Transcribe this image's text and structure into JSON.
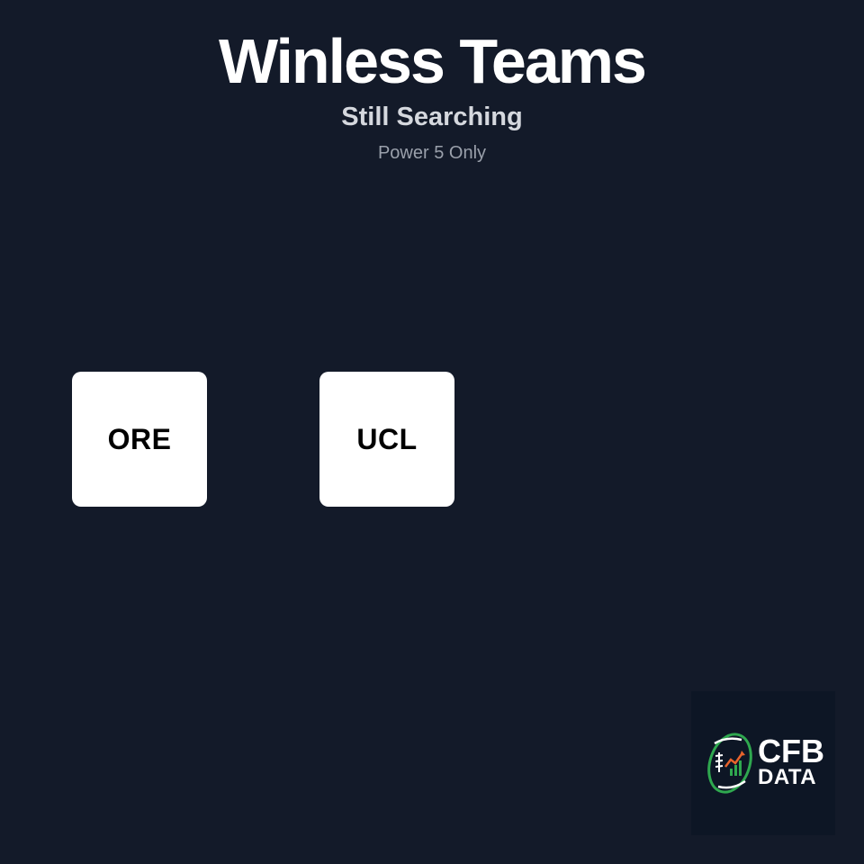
{
  "header": {
    "title": "Winless Teams",
    "subtitle": "Still Searching",
    "note": "Power 5 Only"
  },
  "teams": [
    {
      "abbr": "ORE"
    },
    {
      "abbr": "UCL"
    }
  ],
  "logo": {
    "line1": "CFB",
    "line2": "DATA",
    "icon": "football-chart-icon"
  },
  "colors": {
    "background": "#131a29",
    "card": "#ffffff",
    "logo_green": "#2fa84f",
    "logo_orange": "#e8632c"
  }
}
